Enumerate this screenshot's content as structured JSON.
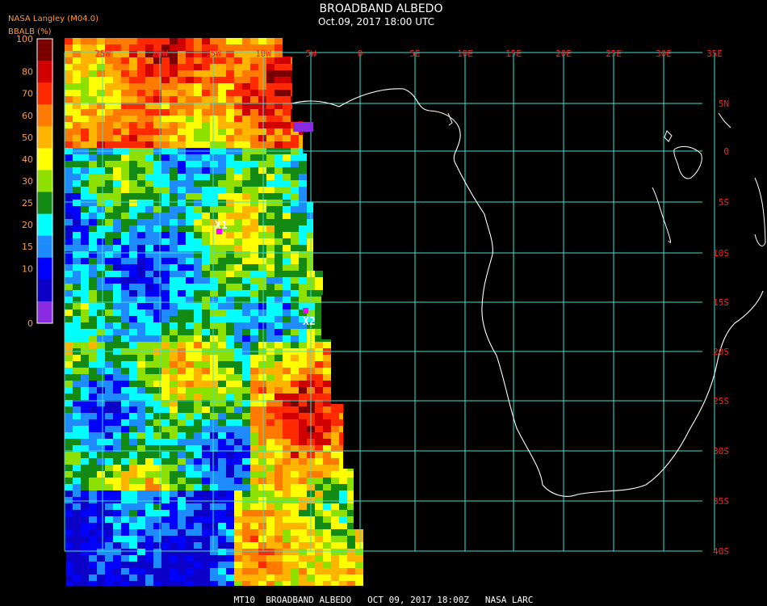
{
  "header": {
    "title": "BROADBAND ALBEDO",
    "subtitle": "Oct.09, 2017 18:00 UTC",
    "provider": "NASA Langley (M04.0)",
    "legend_label": "BBALB (%)"
  },
  "legend": {
    "ticks": [
      "100",
      "80",
      "70",
      "60",
      "50",
      "40",
      "30",
      "25",
      "20",
      "15",
      "10",
      "0"
    ],
    "colors": [
      "#7a0000",
      "#d00000",
      "#ff2a00",
      "#ff7a00",
      "#ffb400",
      "#ffff00",
      "#8ee000",
      "#138a13",
      "#00ffff",
      "#1e8cff",
      "#0000ff",
      "#0a00c8",
      "#8a2be2"
    ]
  },
  "grid": {
    "lon_labels": [
      "25W",
      "20W",
      "15W",
      "10W",
      "5W",
      "0",
      "5E",
      "10E",
      "15E",
      "20E",
      "25E",
      "30E",
      "35E"
    ],
    "lat_labels": [
      "5N",
      "0",
      "5S",
      "10S",
      "15S",
      "20S",
      "25S",
      "30S",
      "35S",
      "40S"
    ],
    "grid_color": "#40e0d0",
    "label_color": "#ff2020"
  },
  "markers": [
    {
      "label": "X1",
      "color": "#ff00ff"
    },
    {
      "label": "X2",
      "color": "#ff00ff"
    }
  ],
  "footer": {
    "text": "MT10  BROADBAND ALBEDO   OCT 09, 2017 18:00Z   NASA LARC"
  }
}
